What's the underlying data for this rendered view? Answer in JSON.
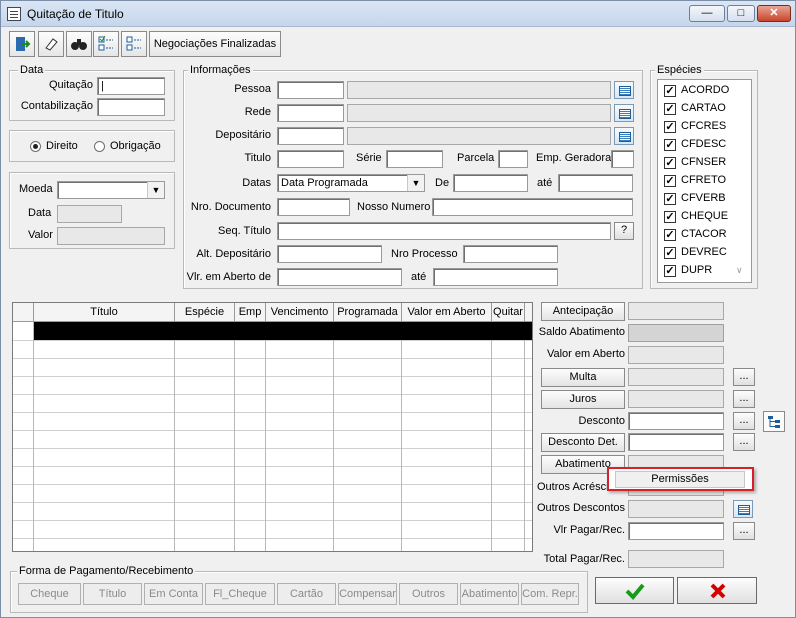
{
  "window": {
    "title": "Quitação de Titulo",
    "controls": [
      "—",
      "□",
      "✕"
    ]
  },
  "toolbar": {
    "negociacoes_label": "Negociações Finalizadas"
  },
  "data_group": {
    "title": "Data",
    "quitacao_label": "Quitação",
    "quitacao_value": "|",
    "contabilizacao_label": "Contabilização",
    "contabilizacao_value": ""
  },
  "tipo": {
    "direito_label": "Direito",
    "obrigacao_label": "Obrigação",
    "selected": "Direito"
  },
  "moeda_group": {
    "moeda_label": "Moeda",
    "moeda_value": "",
    "data_label": "Data",
    "valor_label": "Valor"
  },
  "informacoes": {
    "title": "Informações",
    "pessoa_label": "Pessoa",
    "rede_label": "Rede",
    "depositario_label": "Depositário",
    "titulo_label": "Titulo",
    "serie_label": "Série",
    "parcela_label": "Parcela",
    "emp_geradora_label": "Emp. Geradora",
    "datas_label": "Datas",
    "datas_value": "Data Programada",
    "de_label": "De",
    "ate_label": "até",
    "nro_documento_label": "Nro. Documento",
    "nosso_numero_label": "Nosso Numero",
    "seq_titulo_label": "Seq. Título",
    "seq_btn": "?",
    "alt_depositario_label": "Alt. Depositário",
    "nro_processo_label": "Nro Processo",
    "vlr_aberto_label": "Vlr. em Aberto de",
    "vlr_ate_label": "até"
  },
  "especies": {
    "title": "Espécies",
    "items": [
      "ACORDO",
      "CARTAO",
      "CFCRES",
      "CFDESC",
      "CFNSER",
      "CFRETO",
      "CFVERB",
      "CHEQUE",
      "CTACOR",
      "DEVREC",
      "DUPR"
    ]
  },
  "grid": {
    "columns": [
      "Título",
      "Espécie",
      "Emp",
      "Vencimento",
      "Programada",
      "Valor em Aberto",
      "Quitar"
    ]
  },
  "right_panel": {
    "antecipacao": "Antecipação",
    "saldo_abatimento": "Saldo Abatimento",
    "valor_em_aberto": "Valor em Aberto",
    "multa": "Multa",
    "juros": "Juros",
    "desconto": "Desconto",
    "desconto_det": "Desconto Det.",
    "abatimento": "Abatimento",
    "outros_acrescimos": "Outros Acréscimos",
    "outros_descontos": "Outros Descontos",
    "vlr_pagar": "Vlr Pagar/Rec.",
    "total_pagar": "Total Pagar/Rec.",
    "ellipsis": "..."
  },
  "context_menu": {
    "item": "Permissões"
  },
  "forma_pagamento": {
    "title": "Forma de Pagamento/Recebimento",
    "buttons": [
      "Cheque",
      "Título",
      "Em Conta",
      "Fl_Cheque",
      "Cartão",
      "Compensar",
      "Outros",
      "Abatimento",
      "Com. Repr."
    ]
  },
  "actions": {
    "ok_icon": "check-icon",
    "cancel_icon": "x-icon",
    "ok_color": "#1a9a1a",
    "cancel_color": "#d40000"
  }
}
